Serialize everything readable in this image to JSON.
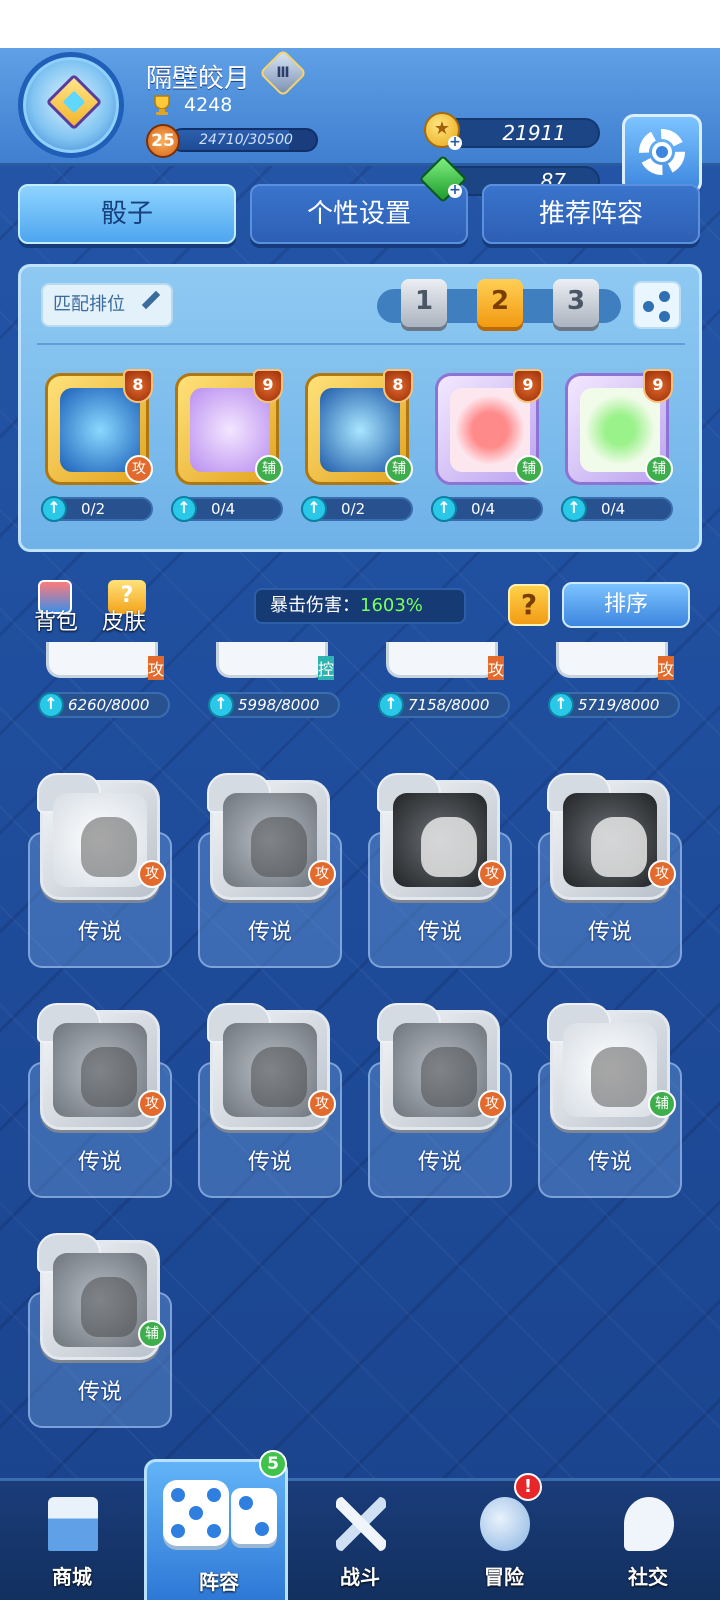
{
  "colors": {
    "accent": "#4ea6ef",
    "attack_role": "#e26a2c",
    "support_role": "#3eae4d",
    "control_role": "#2fb3b0",
    "crit_value": "#7bff5a",
    "alert": "#e8262a"
  },
  "header": {
    "player_name": "隔壁皎月",
    "rank_badge_icon": "rank-diamond-icon",
    "trophies": "4248",
    "level": "25",
    "xp_text": "24710/30500",
    "xp_progress": 0.81,
    "coins": "21911",
    "gems": "87",
    "settings_icon": "gear-icon"
  },
  "tabs": [
    {
      "label": "骰子",
      "active": true
    },
    {
      "label": "个性设置",
      "active": false
    },
    {
      "label": "推荐阵容",
      "active": false
    }
  ],
  "deck": {
    "match_button_label": "匹配排位",
    "slots": [
      "1",
      "2",
      "3"
    ],
    "active_slot": "2",
    "cards": [
      {
        "level": "8",
        "role": "攻",
        "progress": "0/2",
        "icon": "silhouette-warrior-icon"
      },
      {
        "level": "9",
        "role": "辅",
        "progress": "0/4",
        "icon": "altar-flame-icon"
      },
      {
        "level": "8",
        "role": "辅",
        "progress": "0/2",
        "icon": "aries-ram-icon"
      },
      {
        "level": "9",
        "role": "辅",
        "progress": "0/4",
        "icon": "red-hat-icon"
      },
      {
        "level": "9",
        "role": "辅",
        "progress": "0/4",
        "icon": "green-cross-icon"
      }
    ]
  },
  "toolbar": {
    "bag_label": "背包",
    "skin_label": "皮肤",
    "crit_label": "暴击伤害：",
    "crit_value": "1603%",
    "help_label": "?",
    "sort_label": "排序"
  },
  "collection": {
    "partial_row": [
      {
        "role": "攻",
        "progress": "6260/8000"
      },
      {
        "role": "控",
        "progress": "5998/8000"
      },
      {
        "role": "攻",
        "progress": "7158/8000"
      },
      {
        "role": "攻",
        "progress": "5719/8000"
      }
    ],
    "locked_cards": [
      {
        "rarity": "传说",
        "role": "攻",
        "icon": "centaur-archer-icon"
      },
      {
        "rarity": "传说",
        "role": "攻",
        "icon": "gemini-twins-icon"
      },
      {
        "rarity": "传说",
        "role": "攻",
        "icon": "ox-head-icon"
      },
      {
        "rarity": "传说",
        "role": "攻",
        "icon": "rabbit-icon"
      },
      {
        "rarity": "传说",
        "role": "攻",
        "icon": "capricorn-icon"
      },
      {
        "rarity": "传说",
        "role": "攻",
        "icon": "whirl-swirl-icon"
      },
      {
        "rarity": "传说",
        "role": "攻",
        "icon": "crystal-cluster-icon"
      },
      {
        "rarity": "传说",
        "role": "辅",
        "icon": "praying-monk-icon"
      },
      {
        "rarity": "传说",
        "role": "辅",
        "icon": "leopard-back-icon"
      }
    ]
  },
  "nav": [
    {
      "label": "商城",
      "icon": "shop-icon"
    },
    {
      "label": "阵容",
      "icon": "dice-icon",
      "badge": "5",
      "active": true
    },
    {
      "label": "战斗",
      "icon": "crossed-swords-icon"
    },
    {
      "label": "冒险",
      "icon": "planet-icon",
      "alert": "!"
    },
    {
      "label": "社交",
      "icon": "chat-bubble-icon"
    }
  ]
}
